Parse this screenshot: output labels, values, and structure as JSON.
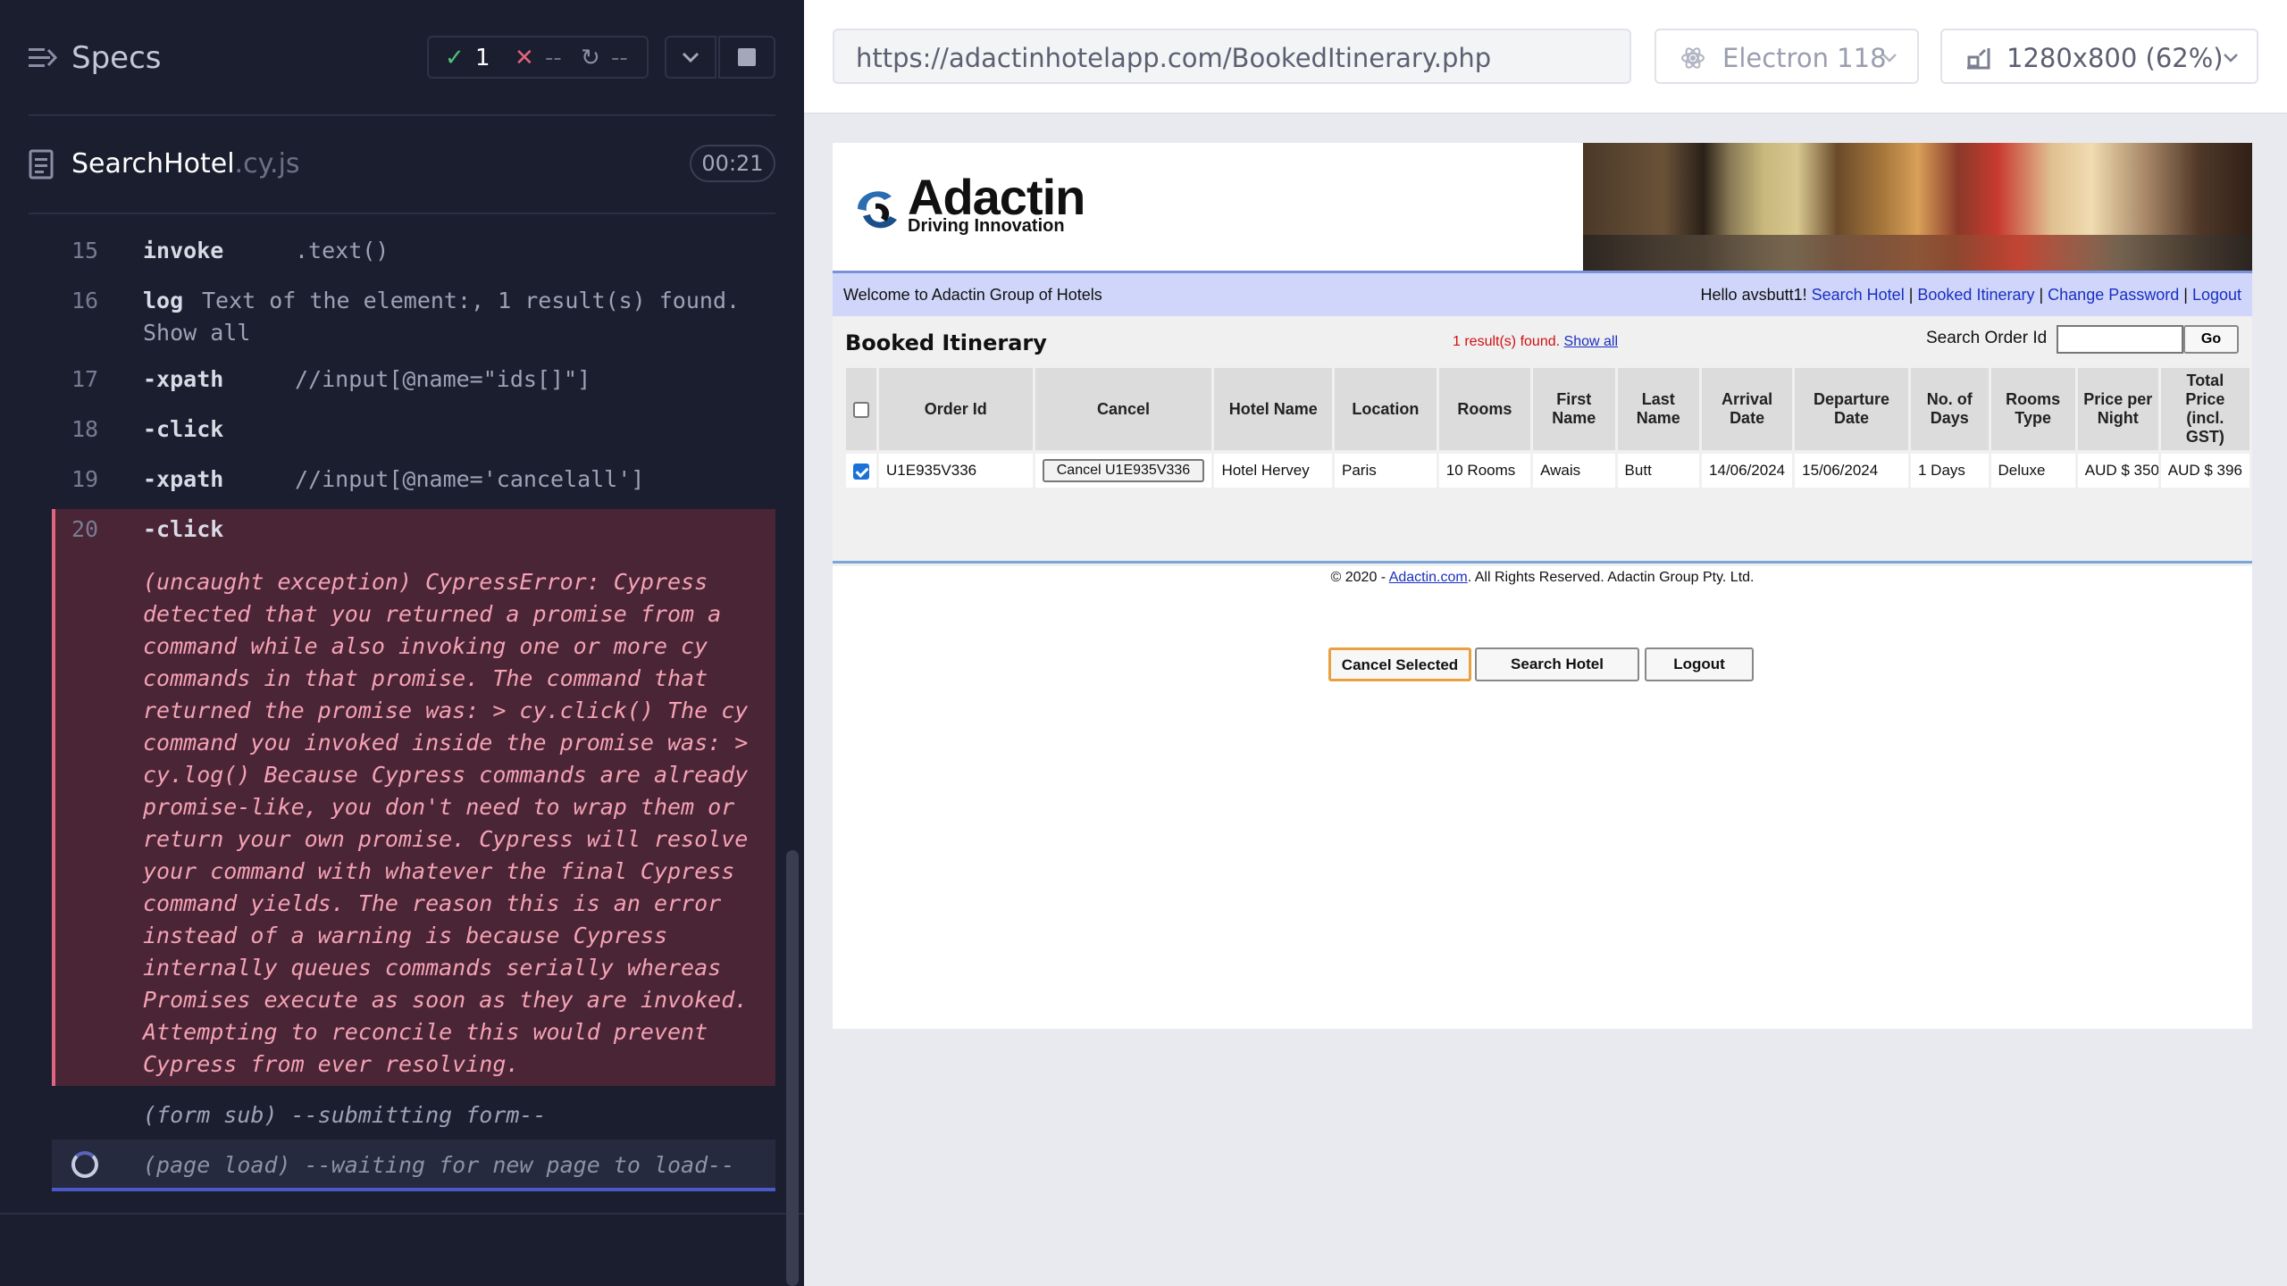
{
  "reporter": {
    "specs_title": "Specs",
    "stats": {
      "passed": "1",
      "failed": "--",
      "pending": "--"
    },
    "spec_file": {
      "name": "SearchHotel",
      "ext": ".cy.js"
    },
    "duration": "00:21",
    "commands": [
      {
        "num": "15",
        "name": "invoke",
        "message": ".text()"
      },
      {
        "num": "16",
        "name": "log",
        "message": "Text of the element:, 1 result(s) found.",
        "message2": "Show all"
      },
      {
        "num": "17",
        "name": "-xpath",
        "message": "//input[@name=\"ids[]\"]"
      },
      {
        "num": "18",
        "name": "-click",
        "message": ""
      },
      {
        "num": "19",
        "name": "-xpath",
        "message": "//input[@name='cancelall']"
      },
      {
        "num": "20",
        "name": "-click",
        "message": ""
      }
    ],
    "error_lines": [
      "(uncaught exception)  CypressError: Cypress",
      "detected that you returned a promise from a",
      "command while also invoking one or more cy",
      "commands in that promise. The command that",
      "returned the promise was: > cy.click() The cy",
      "command you invoked inside the promise was: >",
      "cy.log() Because Cypress commands are already",
      "promise-like, you don't need to wrap them or",
      "return your own promise. Cypress will resolve",
      "your command with whatever the final Cypress",
      "command yields. The reason this is an error",
      "instead of a warning is because Cypress",
      "internally queues commands serially whereas",
      "Promises execute as soon as they are invoked.",
      "Attempting to reconcile this would prevent",
      "Cypress from ever resolving."
    ],
    "form_sub": "(form sub)  --submitting form--",
    "page_load": "(page load)  --waiting for new page to load--"
  },
  "aut": {
    "url": "https://adactinhotelapp.com/BookedItinerary.php",
    "browser": "Electron 118",
    "viewport": "1280x800  (62%)"
  },
  "page": {
    "logo_word": "Adactin",
    "logo_tag": "Driving Innovation",
    "welcome": "Welcome to Adactin Group of Hotels",
    "hello": "Hello avsbutt1!",
    "nav": [
      "Search Hotel",
      "Booked Itinerary",
      "Change Password",
      "Logout"
    ],
    "title": "Booked Itinerary",
    "results": "1 result(s) found.",
    "show_all": "Show all",
    "search_order_label": "Search Order Id",
    "go_label": "Go",
    "columns": [
      "Order Id",
      "Cancel",
      "Hotel Name",
      "Location",
      "Rooms",
      "First Name",
      "Last Name",
      "Arrival Date",
      "Departure Date",
      "No. of Days",
      "Rooms Type",
      "Price per Night",
      "Total Price (incl. GST)"
    ],
    "row": {
      "order_id": "U1E935V336",
      "cancel": "Cancel U1E935V336",
      "hotel": "Hotel Hervey",
      "location": "Paris",
      "rooms": "10 Rooms",
      "first": "Awais",
      "last": "Butt",
      "arrival": "14/06/2024",
      "departure": "15/06/2024",
      "days": "1 Days",
      "type": "Deluxe",
      "price": "AUD $ 350",
      "total": "AUD $ 396"
    },
    "buttons": {
      "cancel_selected": "Cancel Selected",
      "search_hotel": "Search Hotel",
      "logout": "Logout"
    },
    "footer_pre": "© 2020 - ",
    "footer_link": "Adactin.com",
    "footer_post": ". All Rights Reserved. Adactin Group Pty. Ltd."
  },
  "colors": {
    "passed": "#4ec27a",
    "failed": "#e0657d",
    "error_bg": "#4a2536",
    "accent": "#4a58c8"
  }
}
